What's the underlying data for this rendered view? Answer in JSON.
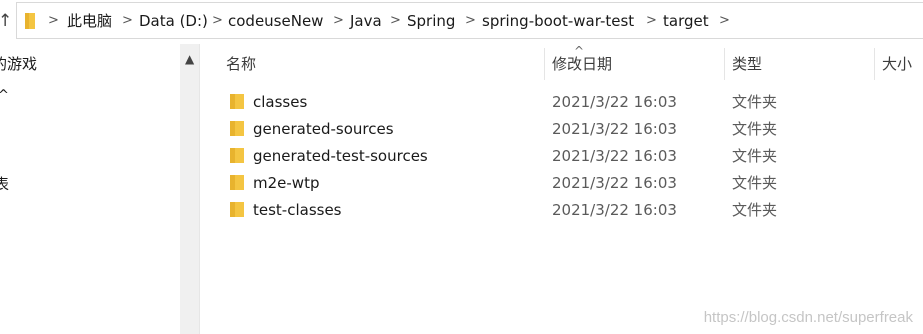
{
  "address_bar": {
    "crumbs": [
      "此电脑",
      "Data (D:)",
      "codeuseNew",
      "Java",
      "Spring",
      "spring-boot-war-test",
      "target"
    ]
  },
  "nav_pane": {
    "items": [
      "的游戏",
      "^",
      "表"
    ]
  },
  "columns": {
    "name": "名称",
    "date": "修改日期",
    "type": "类型",
    "size": "大小"
  },
  "files": [
    {
      "name": "classes",
      "date": "2021/3/22 16:03",
      "type": "文件夹"
    },
    {
      "name": "generated-sources",
      "date": "2021/3/22 16:03",
      "type": "文件夹"
    },
    {
      "name": "generated-test-sources",
      "date": "2021/3/22 16:03",
      "type": "文件夹"
    },
    {
      "name": "m2e-wtp",
      "date": "2021/3/22 16:03",
      "type": "文件夹"
    },
    {
      "name": "test-classes",
      "date": "2021/3/22 16:03",
      "type": "文件夹"
    }
  ],
  "watermark": "https://blog.csdn.net/superfreak",
  "colors": {
    "folder": "#f4c542",
    "folder_dark": "#e0a800"
  }
}
